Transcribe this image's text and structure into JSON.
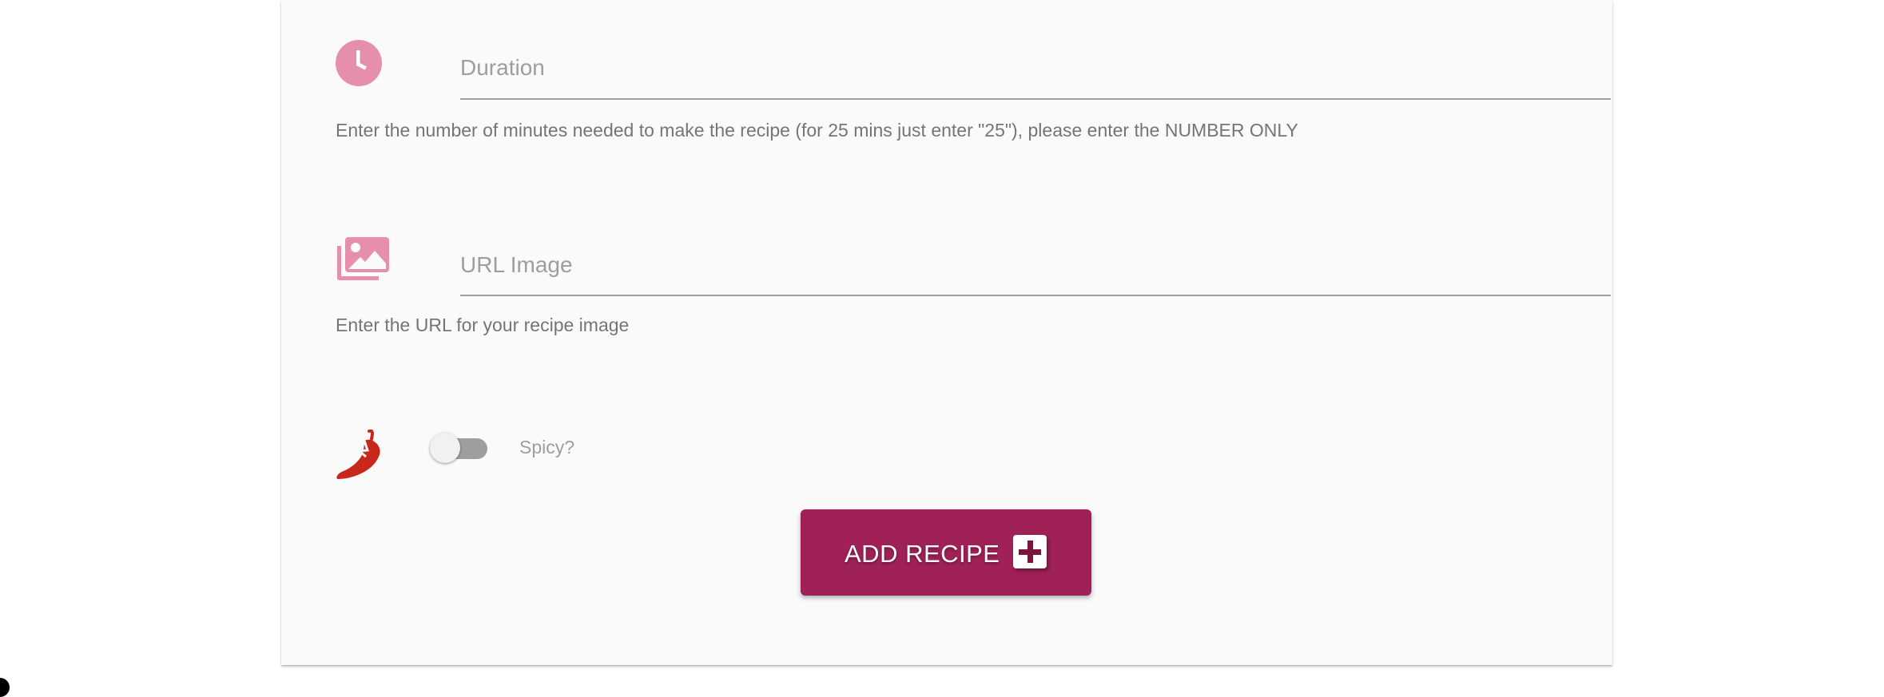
{
  "form": {
    "duration": {
      "icon": "clock-icon",
      "placeholder": "Duration",
      "value": "",
      "helper": "Enter the number of minutes needed to make the recipe (for 25 mins just enter \"25\"), please enter the NUMBER ONLY"
    },
    "url_image": {
      "icon": "images-icon",
      "placeholder": "URL Image",
      "value": "",
      "helper": "Enter the URL for your recipe image"
    },
    "spicy": {
      "icon": "chili-pepper-icon",
      "label": "Spicy?",
      "checked": false
    },
    "submit": {
      "label": "ADD RECIPE",
      "icon": "plus-square-icon"
    }
  },
  "colors": {
    "icon_pink": "#e58faa",
    "chili_red": "#c9261c",
    "button_bg": "#9f2158",
    "card_bg": "#fafafa",
    "switch_off_track": "#9e9e9e"
  }
}
